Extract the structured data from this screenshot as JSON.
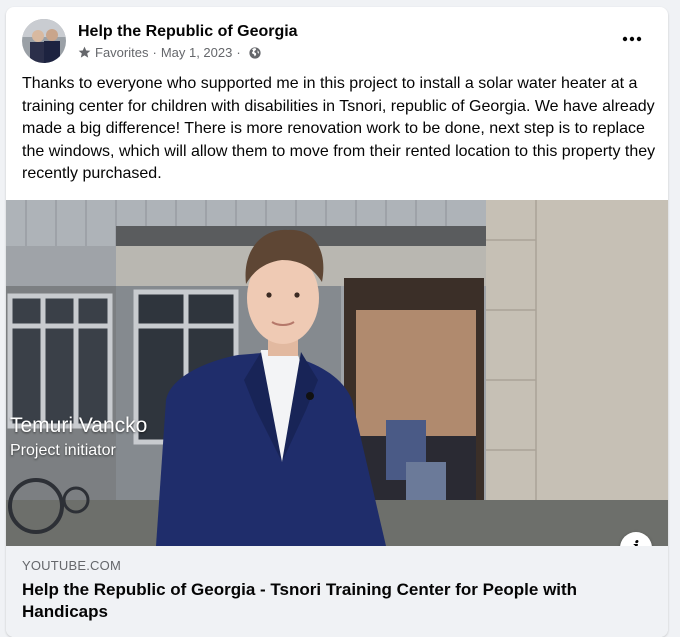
{
  "post": {
    "page_name": "Help the Republic of Georgia",
    "audience": "Favorites",
    "separator": "·",
    "date": "May 1, 2023",
    "text": "Thanks to everyone who supported me in this project to install a solar water heater at a training center for children with disabilities in Tsnori, republic of Georgia. We have already made a big difference!  There is more renovation work to be done, next step is to replace the windows, which will allow them to move from their rented location to this property they recently purchased.",
    "more_label": "•••",
    "icons": {
      "favorites": "star-icon",
      "privacy": "globe-icon",
      "more": "more-options-icon",
      "info": "info-icon"
    }
  },
  "video": {
    "caption_name": "Temuri Vancko",
    "caption_role": "Project initiator",
    "info_label": "i"
  },
  "link_preview": {
    "domain": "YOUTUBE.COM",
    "title": "Help the Republic of Georgia - Tsnori Training Center for People with Handicaps"
  },
  "colors": {
    "page_background": "#f0f2f5",
    "card_background": "#ffffff",
    "primary_text": "#050505",
    "secondary_text": "#65676b",
    "jacket": "#1f2d6b"
  }
}
